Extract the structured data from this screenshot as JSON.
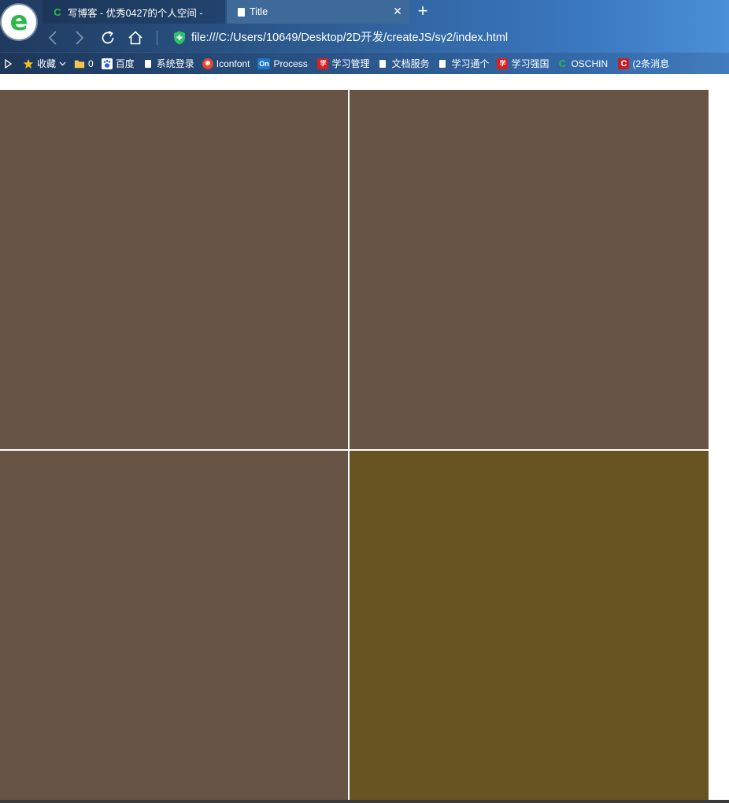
{
  "tabs": [
    {
      "title": "写博客 - 优秀0427的个人空间 - ",
      "icon": "c-icon",
      "active": false
    },
    {
      "title": "Title",
      "icon": "document-icon",
      "active": true
    }
  ],
  "address": {
    "url": "file:///C:/Users/10649/Desktop/2D开发/createJS/sy2/index.html"
  },
  "bookmarks": [
    {
      "label": "收藏",
      "icon": "star-icon",
      "color": "#f3c21b"
    },
    {
      "label": "0",
      "icon": "folder-icon",
      "color": "#f5c64a"
    },
    {
      "label": "百度",
      "icon": "baidu-paw-icon",
      "color": "#3062d6"
    },
    {
      "label": "系统登录",
      "icon": "document-icon",
      "color": "#ffffff"
    },
    {
      "label": "Iconfont",
      "icon": "iconfont-icon",
      "color": "#e8432d"
    },
    {
      "label": "Process",
      "icon": "processon-icon",
      "color": "#1b78c8"
    },
    {
      "label": "学习管理",
      "icon": "xuexi-icon",
      "color": "#d82020"
    },
    {
      "label": "文档服务",
      "icon": "document-icon",
      "color": "#ffffff"
    },
    {
      "label": "学习通个",
      "icon": "document-icon",
      "color": "#ffffff"
    },
    {
      "label": "学习强国",
      "icon": "xuexi-icon",
      "color": "#d82020"
    },
    {
      "label": "OSCHIN",
      "icon": "oschina-icon",
      "color": "#2db84a"
    },
    {
      "label": "(2条消息",
      "icon": "csdn-icon",
      "color": "#c71d23"
    }
  ],
  "canvas": {
    "tiles": [
      {
        "name": "tile-top-left",
        "color": "#685445"
      },
      {
        "name": "tile-top-right",
        "color": "#685445"
      },
      {
        "name": "tile-bottom-left",
        "color": "#685445"
      },
      {
        "name": "tile-bottom-right",
        "color": "#685323"
      }
    ]
  }
}
